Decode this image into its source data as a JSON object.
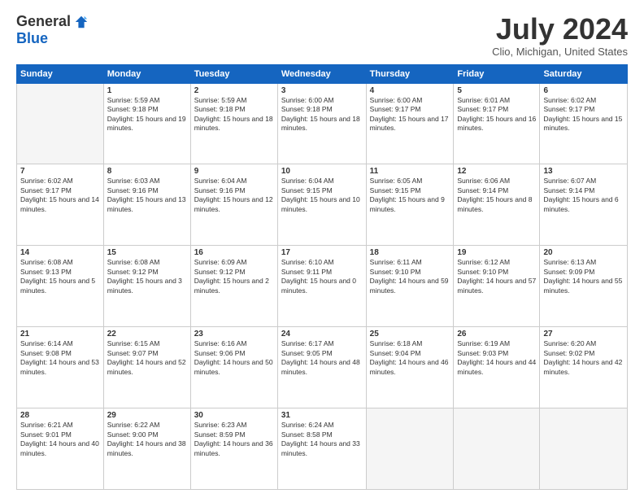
{
  "header": {
    "logo_general": "General",
    "logo_blue": "Blue",
    "title": "July 2024",
    "location": "Clio, Michigan, United States"
  },
  "days_of_week": [
    "Sunday",
    "Monday",
    "Tuesday",
    "Wednesday",
    "Thursday",
    "Friday",
    "Saturday"
  ],
  "weeks": [
    [
      {
        "num": "",
        "sunrise": "",
        "sunset": "",
        "daylight": "",
        "empty": true
      },
      {
        "num": "1",
        "sunrise": "Sunrise: 5:59 AM",
        "sunset": "Sunset: 9:18 PM",
        "daylight": "Daylight: 15 hours and 19 minutes."
      },
      {
        "num": "2",
        "sunrise": "Sunrise: 5:59 AM",
        "sunset": "Sunset: 9:18 PM",
        "daylight": "Daylight: 15 hours and 18 minutes."
      },
      {
        "num": "3",
        "sunrise": "Sunrise: 6:00 AM",
        "sunset": "Sunset: 9:18 PM",
        "daylight": "Daylight: 15 hours and 18 minutes."
      },
      {
        "num": "4",
        "sunrise": "Sunrise: 6:00 AM",
        "sunset": "Sunset: 9:17 PM",
        "daylight": "Daylight: 15 hours and 17 minutes."
      },
      {
        "num": "5",
        "sunrise": "Sunrise: 6:01 AM",
        "sunset": "Sunset: 9:17 PM",
        "daylight": "Daylight: 15 hours and 16 minutes."
      },
      {
        "num": "6",
        "sunrise": "Sunrise: 6:02 AM",
        "sunset": "Sunset: 9:17 PM",
        "daylight": "Daylight: 15 hours and 15 minutes."
      }
    ],
    [
      {
        "num": "7",
        "sunrise": "Sunrise: 6:02 AM",
        "sunset": "Sunset: 9:17 PM",
        "daylight": "Daylight: 15 hours and 14 minutes."
      },
      {
        "num": "8",
        "sunrise": "Sunrise: 6:03 AM",
        "sunset": "Sunset: 9:16 PM",
        "daylight": "Daylight: 15 hours and 13 minutes."
      },
      {
        "num": "9",
        "sunrise": "Sunrise: 6:04 AM",
        "sunset": "Sunset: 9:16 PM",
        "daylight": "Daylight: 15 hours and 12 minutes."
      },
      {
        "num": "10",
        "sunrise": "Sunrise: 6:04 AM",
        "sunset": "Sunset: 9:15 PM",
        "daylight": "Daylight: 15 hours and 10 minutes."
      },
      {
        "num": "11",
        "sunrise": "Sunrise: 6:05 AM",
        "sunset": "Sunset: 9:15 PM",
        "daylight": "Daylight: 15 hours and 9 minutes."
      },
      {
        "num": "12",
        "sunrise": "Sunrise: 6:06 AM",
        "sunset": "Sunset: 9:14 PM",
        "daylight": "Daylight: 15 hours and 8 minutes."
      },
      {
        "num": "13",
        "sunrise": "Sunrise: 6:07 AM",
        "sunset": "Sunset: 9:14 PM",
        "daylight": "Daylight: 15 hours and 6 minutes."
      }
    ],
    [
      {
        "num": "14",
        "sunrise": "Sunrise: 6:08 AM",
        "sunset": "Sunset: 9:13 PM",
        "daylight": "Daylight: 15 hours and 5 minutes."
      },
      {
        "num": "15",
        "sunrise": "Sunrise: 6:08 AM",
        "sunset": "Sunset: 9:12 PM",
        "daylight": "Daylight: 15 hours and 3 minutes."
      },
      {
        "num": "16",
        "sunrise": "Sunrise: 6:09 AM",
        "sunset": "Sunset: 9:12 PM",
        "daylight": "Daylight: 15 hours and 2 minutes."
      },
      {
        "num": "17",
        "sunrise": "Sunrise: 6:10 AM",
        "sunset": "Sunset: 9:11 PM",
        "daylight": "Daylight: 15 hours and 0 minutes."
      },
      {
        "num": "18",
        "sunrise": "Sunrise: 6:11 AM",
        "sunset": "Sunset: 9:10 PM",
        "daylight": "Daylight: 14 hours and 59 minutes."
      },
      {
        "num": "19",
        "sunrise": "Sunrise: 6:12 AM",
        "sunset": "Sunset: 9:10 PM",
        "daylight": "Daylight: 14 hours and 57 minutes."
      },
      {
        "num": "20",
        "sunrise": "Sunrise: 6:13 AM",
        "sunset": "Sunset: 9:09 PM",
        "daylight": "Daylight: 14 hours and 55 minutes."
      }
    ],
    [
      {
        "num": "21",
        "sunrise": "Sunrise: 6:14 AM",
        "sunset": "Sunset: 9:08 PM",
        "daylight": "Daylight: 14 hours and 53 minutes."
      },
      {
        "num": "22",
        "sunrise": "Sunrise: 6:15 AM",
        "sunset": "Sunset: 9:07 PM",
        "daylight": "Daylight: 14 hours and 52 minutes."
      },
      {
        "num": "23",
        "sunrise": "Sunrise: 6:16 AM",
        "sunset": "Sunset: 9:06 PM",
        "daylight": "Daylight: 14 hours and 50 minutes."
      },
      {
        "num": "24",
        "sunrise": "Sunrise: 6:17 AM",
        "sunset": "Sunset: 9:05 PM",
        "daylight": "Daylight: 14 hours and 48 minutes."
      },
      {
        "num": "25",
        "sunrise": "Sunrise: 6:18 AM",
        "sunset": "Sunset: 9:04 PM",
        "daylight": "Daylight: 14 hours and 46 minutes."
      },
      {
        "num": "26",
        "sunrise": "Sunrise: 6:19 AM",
        "sunset": "Sunset: 9:03 PM",
        "daylight": "Daylight: 14 hours and 44 minutes."
      },
      {
        "num": "27",
        "sunrise": "Sunrise: 6:20 AM",
        "sunset": "Sunset: 9:02 PM",
        "daylight": "Daylight: 14 hours and 42 minutes."
      }
    ],
    [
      {
        "num": "28",
        "sunrise": "Sunrise: 6:21 AM",
        "sunset": "Sunset: 9:01 PM",
        "daylight": "Daylight: 14 hours and 40 minutes."
      },
      {
        "num": "29",
        "sunrise": "Sunrise: 6:22 AM",
        "sunset": "Sunset: 9:00 PM",
        "daylight": "Daylight: 14 hours and 38 minutes."
      },
      {
        "num": "30",
        "sunrise": "Sunrise: 6:23 AM",
        "sunset": "Sunset: 8:59 PM",
        "daylight": "Daylight: 14 hours and 36 minutes."
      },
      {
        "num": "31",
        "sunrise": "Sunrise: 6:24 AM",
        "sunset": "Sunset: 8:58 PM",
        "daylight": "Daylight: 14 hours and 33 minutes."
      },
      {
        "num": "",
        "sunrise": "",
        "sunset": "",
        "daylight": "",
        "empty": true
      },
      {
        "num": "",
        "sunrise": "",
        "sunset": "",
        "daylight": "",
        "empty": true
      },
      {
        "num": "",
        "sunrise": "",
        "sunset": "",
        "daylight": "",
        "empty": true
      }
    ]
  ]
}
